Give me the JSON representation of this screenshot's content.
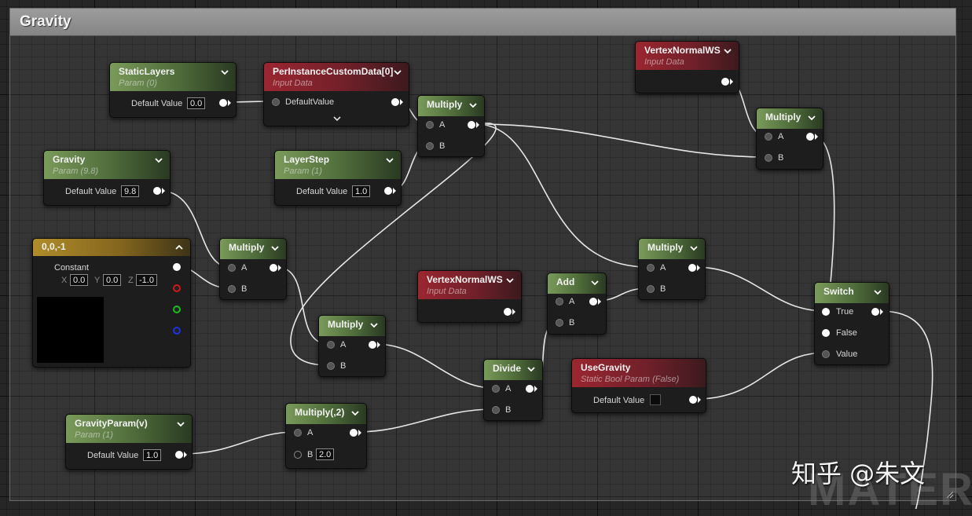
{
  "comment": {
    "title": "Gravity"
  },
  "nodes": {
    "static_layers": {
      "title": "StaticLayers",
      "subtitle": "Param (0)",
      "value_label": "Default Value",
      "value": "0.0"
    },
    "per_instance": {
      "title": "PerInstanceCustomData[0]",
      "subtitle": "Input Data",
      "input_label": "DefaultValue"
    },
    "multiply_1": {
      "title": "Multiply",
      "pin_a": "A",
      "pin_b": "B"
    },
    "vertex_normal_1": {
      "title": "VertexNormalWS",
      "subtitle": "Input Data"
    },
    "multiply_2": {
      "title": "Multiply",
      "pin_a": "A",
      "pin_b": "B"
    },
    "gravity": {
      "title": "Gravity",
      "subtitle": "Param (9.8)",
      "value_label": "Default Value",
      "value": "9.8"
    },
    "layer_step": {
      "title": "LayerStep",
      "subtitle": "Param (1)",
      "value_label": "Default Value",
      "value": "1.0"
    },
    "constant": {
      "title": "0,0,-1",
      "label": "Constant",
      "x_label": "X",
      "x": "0.0",
      "y_label": "Y",
      "y": "0.0",
      "z_label": "Z",
      "z": "-1.0"
    },
    "multiply_3": {
      "title": "Multiply",
      "pin_a": "A",
      "pin_b": "B"
    },
    "vertex_normal_2": {
      "title": "VertexNormalWS",
      "subtitle": "Input Data"
    },
    "add": {
      "title": "Add",
      "pin_a": "A",
      "pin_b": "B"
    },
    "multiply_4": {
      "title": "Multiply",
      "pin_a": "A",
      "pin_b": "B"
    },
    "switch": {
      "title": "Switch",
      "pin_true": "True",
      "pin_false": "False",
      "pin_value": "Value"
    },
    "multiply_5": {
      "title": "Multiply",
      "pin_a": "A",
      "pin_b": "B"
    },
    "divide": {
      "title": "Divide",
      "pin_a": "A",
      "pin_b": "B"
    },
    "use_gravity": {
      "title": "UseGravity",
      "subtitle": "Static Bool Param (False)",
      "value_label": "Default Value"
    },
    "gravity_param": {
      "title": "GravityParam(v)",
      "subtitle": "Param (1)",
      "value_label": "Default Value",
      "value": "1.0"
    },
    "multiply_6": {
      "title": "Multiply(,2)",
      "pin_a": "A",
      "pin_b": "B",
      "b_value": "2.0"
    }
  },
  "watermark": {
    "text": "知乎 @朱文",
    "background_text": "MATERIA"
  },
  "colors": {
    "param_header": "#4e6b3a",
    "input_header": "#72202a",
    "constant_header": "#84661e",
    "wire": "#e6e6e6"
  },
  "icons": {
    "collapse": "chevron-down-icon",
    "expand": "chevron-up-icon",
    "resize": "resize-grip-icon"
  }
}
